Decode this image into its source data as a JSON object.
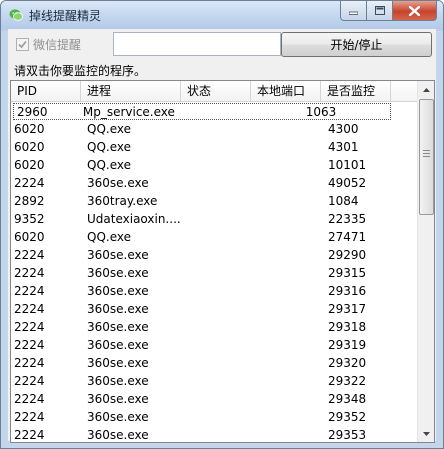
{
  "window": {
    "title": "掉线提醒精灵"
  },
  "toolbar": {
    "wechat_checkbox_label": "微信提醒",
    "wechat_checked": true,
    "input_value": "",
    "start_stop_label": "开始/停止"
  },
  "hint": "请双击你要监控的程序。",
  "table": {
    "columns": [
      "PID",
      "进程",
      "状态",
      "本地端口",
      "是否监控"
    ],
    "rows": [
      [
        "2960",
        "Mp_service.exe",
        "",
        "1063",
        ""
      ],
      [
        "6020",
        "QQ.exe",
        "",
        "4300",
        ""
      ],
      [
        "6020",
        "QQ.exe",
        "",
        "4301",
        ""
      ],
      [
        "6020",
        "QQ.exe",
        "",
        "10101",
        ""
      ],
      [
        "2224",
        "360se.exe",
        "",
        "49052",
        ""
      ],
      [
        "2892",
        "360tray.exe",
        "",
        "1084",
        ""
      ],
      [
        "9352",
        "Udatexiaoxin....",
        "",
        "22335",
        ""
      ],
      [
        "6020",
        "QQ.exe",
        "",
        "27471",
        ""
      ],
      [
        "2224",
        "360se.exe",
        "",
        "29290",
        ""
      ],
      [
        "2224",
        "360se.exe",
        "",
        "29315",
        ""
      ],
      [
        "2224",
        "360se.exe",
        "",
        "29316",
        ""
      ],
      [
        "2224",
        "360se.exe",
        "",
        "29317",
        ""
      ],
      [
        "2224",
        "360se.exe",
        "",
        "29318",
        ""
      ],
      [
        "2224",
        "360se.exe",
        "",
        "29319",
        ""
      ],
      [
        "2224",
        "360se.exe",
        "",
        "29320",
        ""
      ],
      [
        "2224",
        "360se.exe",
        "",
        "29322",
        ""
      ],
      [
        "2224",
        "360se.exe",
        "",
        "29348",
        ""
      ],
      [
        "2224",
        "360se.exe",
        "",
        "29352",
        ""
      ],
      [
        "2224",
        "360se.exe",
        "",
        "29353",
        ""
      ]
    ]
  }
}
